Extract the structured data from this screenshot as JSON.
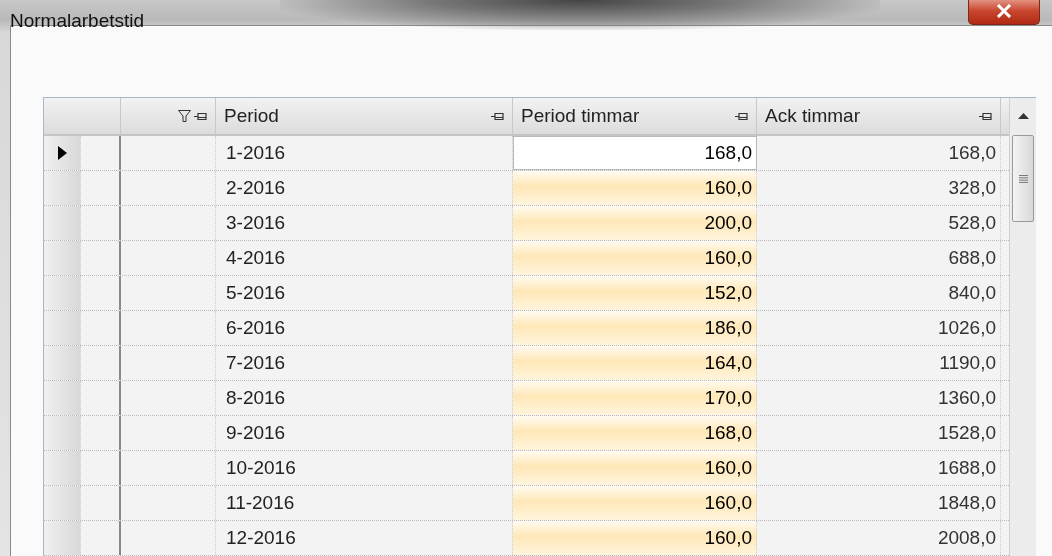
{
  "window": {
    "title": "Normalarbetstid"
  },
  "grid": {
    "columns": [
      {
        "label": "Period",
        "kind": "text"
      },
      {
        "label": "Period timmar",
        "kind": "editable"
      },
      {
        "label": "Ack timmar",
        "kind": "number"
      }
    ],
    "rows": [
      {
        "cells": [
          "1-2016",
          "168,0",
          "168,0"
        ],
        "selected": true
      },
      {
        "cells": [
          "2-2016",
          "160,0",
          "328,0"
        ],
        "selected": false
      },
      {
        "cells": [
          "3-2016",
          "200,0",
          "528,0"
        ],
        "selected": false
      },
      {
        "cells": [
          "4-2016",
          "160,0",
          "688,0"
        ],
        "selected": false
      },
      {
        "cells": [
          "5-2016",
          "152,0",
          "840,0"
        ],
        "selected": false
      },
      {
        "cells": [
          "6-2016",
          "186,0",
          "1026,0"
        ],
        "selected": false
      },
      {
        "cells": [
          "7-2016",
          "164,0",
          "1190,0"
        ],
        "selected": false
      },
      {
        "cells": [
          "8-2016",
          "170,0",
          "1360,0"
        ],
        "selected": false
      },
      {
        "cells": [
          "9-2016",
          "168,0",
          "1528,0"
        ],
        "selected": false
      },
      {
        "cells": [
          "10-2016",
          "160,0",
          "1688,0"
        ],
        "selected": false
      },
      {
        "cells": [
          "11-2016",
          "160,0",
          "1848,0"
        ],
        "selected": false
      },
      {
        "cells": [
          "12-2016",
          "160,0",
          "2008,0"
        ],
        "selected": false
      }
    ]
  }
}
